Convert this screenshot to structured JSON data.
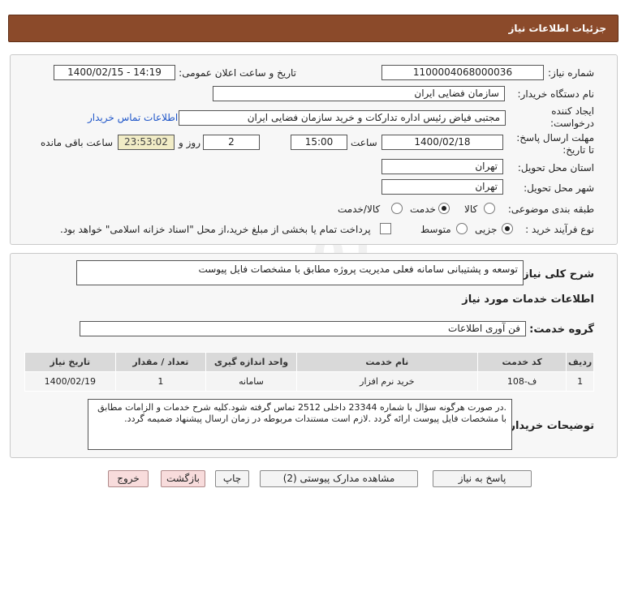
{
  "header": {
    "title": "جزئیات اطلاعات نیاز"
  },
  "labels": {
    "need_number": "شماره نیاز:",
    "announce_datetime": "تاریخ و ساعت اعلان عمومی:",
    "buyer_org": "نام دستگاه خریدار:",
    "requester_line1": "ایجاد کننده",
    "requester_line2": "درخواست:",
    "deadline_line1": "مهلت ارسال پاسخ:",
    "deadline_line2": "تا تاریخ:",
    "time_word": "ساعت",
    "day_word": "روز و",
    "remaining_word": "ساعت باقی مانده",
    "province": "استان محل تحویل:",
    "city": "شهر محل تحویل:",
    "category": "طبقه بندی موضوعی:",
    "purchase_type": "نوع فرآیند خرید :",
    "need_summary": "شرح کلی نیاز:",
    "service_info": "اطلاعات خدمات مورد نیاز",
    "service_group": "گروه خدمت:",
    "buyer_notes": "توضیحات خریدار:"
  },
  "fields": {
    "need_number": "1100004068000036",
    "announce_datetime": "1400/02/15 - 14:19",
    "buyer_org": "سازمان فضایی ایران",
    "requester": "مجتبی  فیاض رئیس اداره تدارکات و خرید سازمان فضایی ایران",
    "contact_link": "اطلاعات تماس خریدار",
    "deadline_date": "1400/02/18",
    "deadline_time": "15:00",
    "remaining_days": "2",
    "remaining_time": "23:53:02",
    "province": "تهران",
    "city": "تهران",
    "need_summary": "توسعه و پشتیبانی سامانه فعلی مدیریت پروژه مطابق با مشخصات فایل پیوست",
    "service_group": "فن آوری اطلاعات",
    "buyer_notes": ".در صورت هرگونه سؤال با شماره 23344 داخلی 2512 تماس گرفته شود.کلیه شرح خدمات و الزامات مطابق با مشخصات فایل پیوست ارائه گردد .لازم است مستندات مربوطه در زمان ارسال پیشنهاد ضمیمه گردد."
  },
  "category_options": [
    {
      "label": "کالا",
      "selected": false
    },
    {
      "label": "خدمت",
      "selected": true
    },
    {
      "label": "کالا/خدمت",
      "selected": false
    }
  ],
  "purchase_options": [
    {
      "label": "جزیی",
      "selected": true
    },
    {
      "label": "متوسط",
      "selected": false
    }
  ],
  "payment_note": "پرداخت تمام یا بخشی از مبلغ خرید،از محل \"اسناد خزانه اسلامی\" خواهد بود.",
  "payment_checked": false,
  "table": {
    "headers": [
      "ردیف",
      "کد خدمت",
      "نام خدمت",
      "واحد اندازه گیری",
      "تعداد / مقدار",
      "تاریخ نیاز"
    ],
    "rows": [
      [
        "1",
        "ف-108",
        "خرید نرم افزار",
        "سامانه",
        "1",
        "1400/02/19"
      ]
    ]
  },
  "buttons": {
    "reply": "پاسخ به نیاز",
    "attachments": "مشاهده مدارک پیوستی (2)",
    "print": "چاپ",
    "back": "بازگشت",
    "exit": "خروج"
  },
  "colors": {
    "header_bg": "#8b4a2a",
    "link": "#1f56c9",
    "pink_button": "#f8dcdc",
    "highlight_field": "#f1ecc6"
  }
}
